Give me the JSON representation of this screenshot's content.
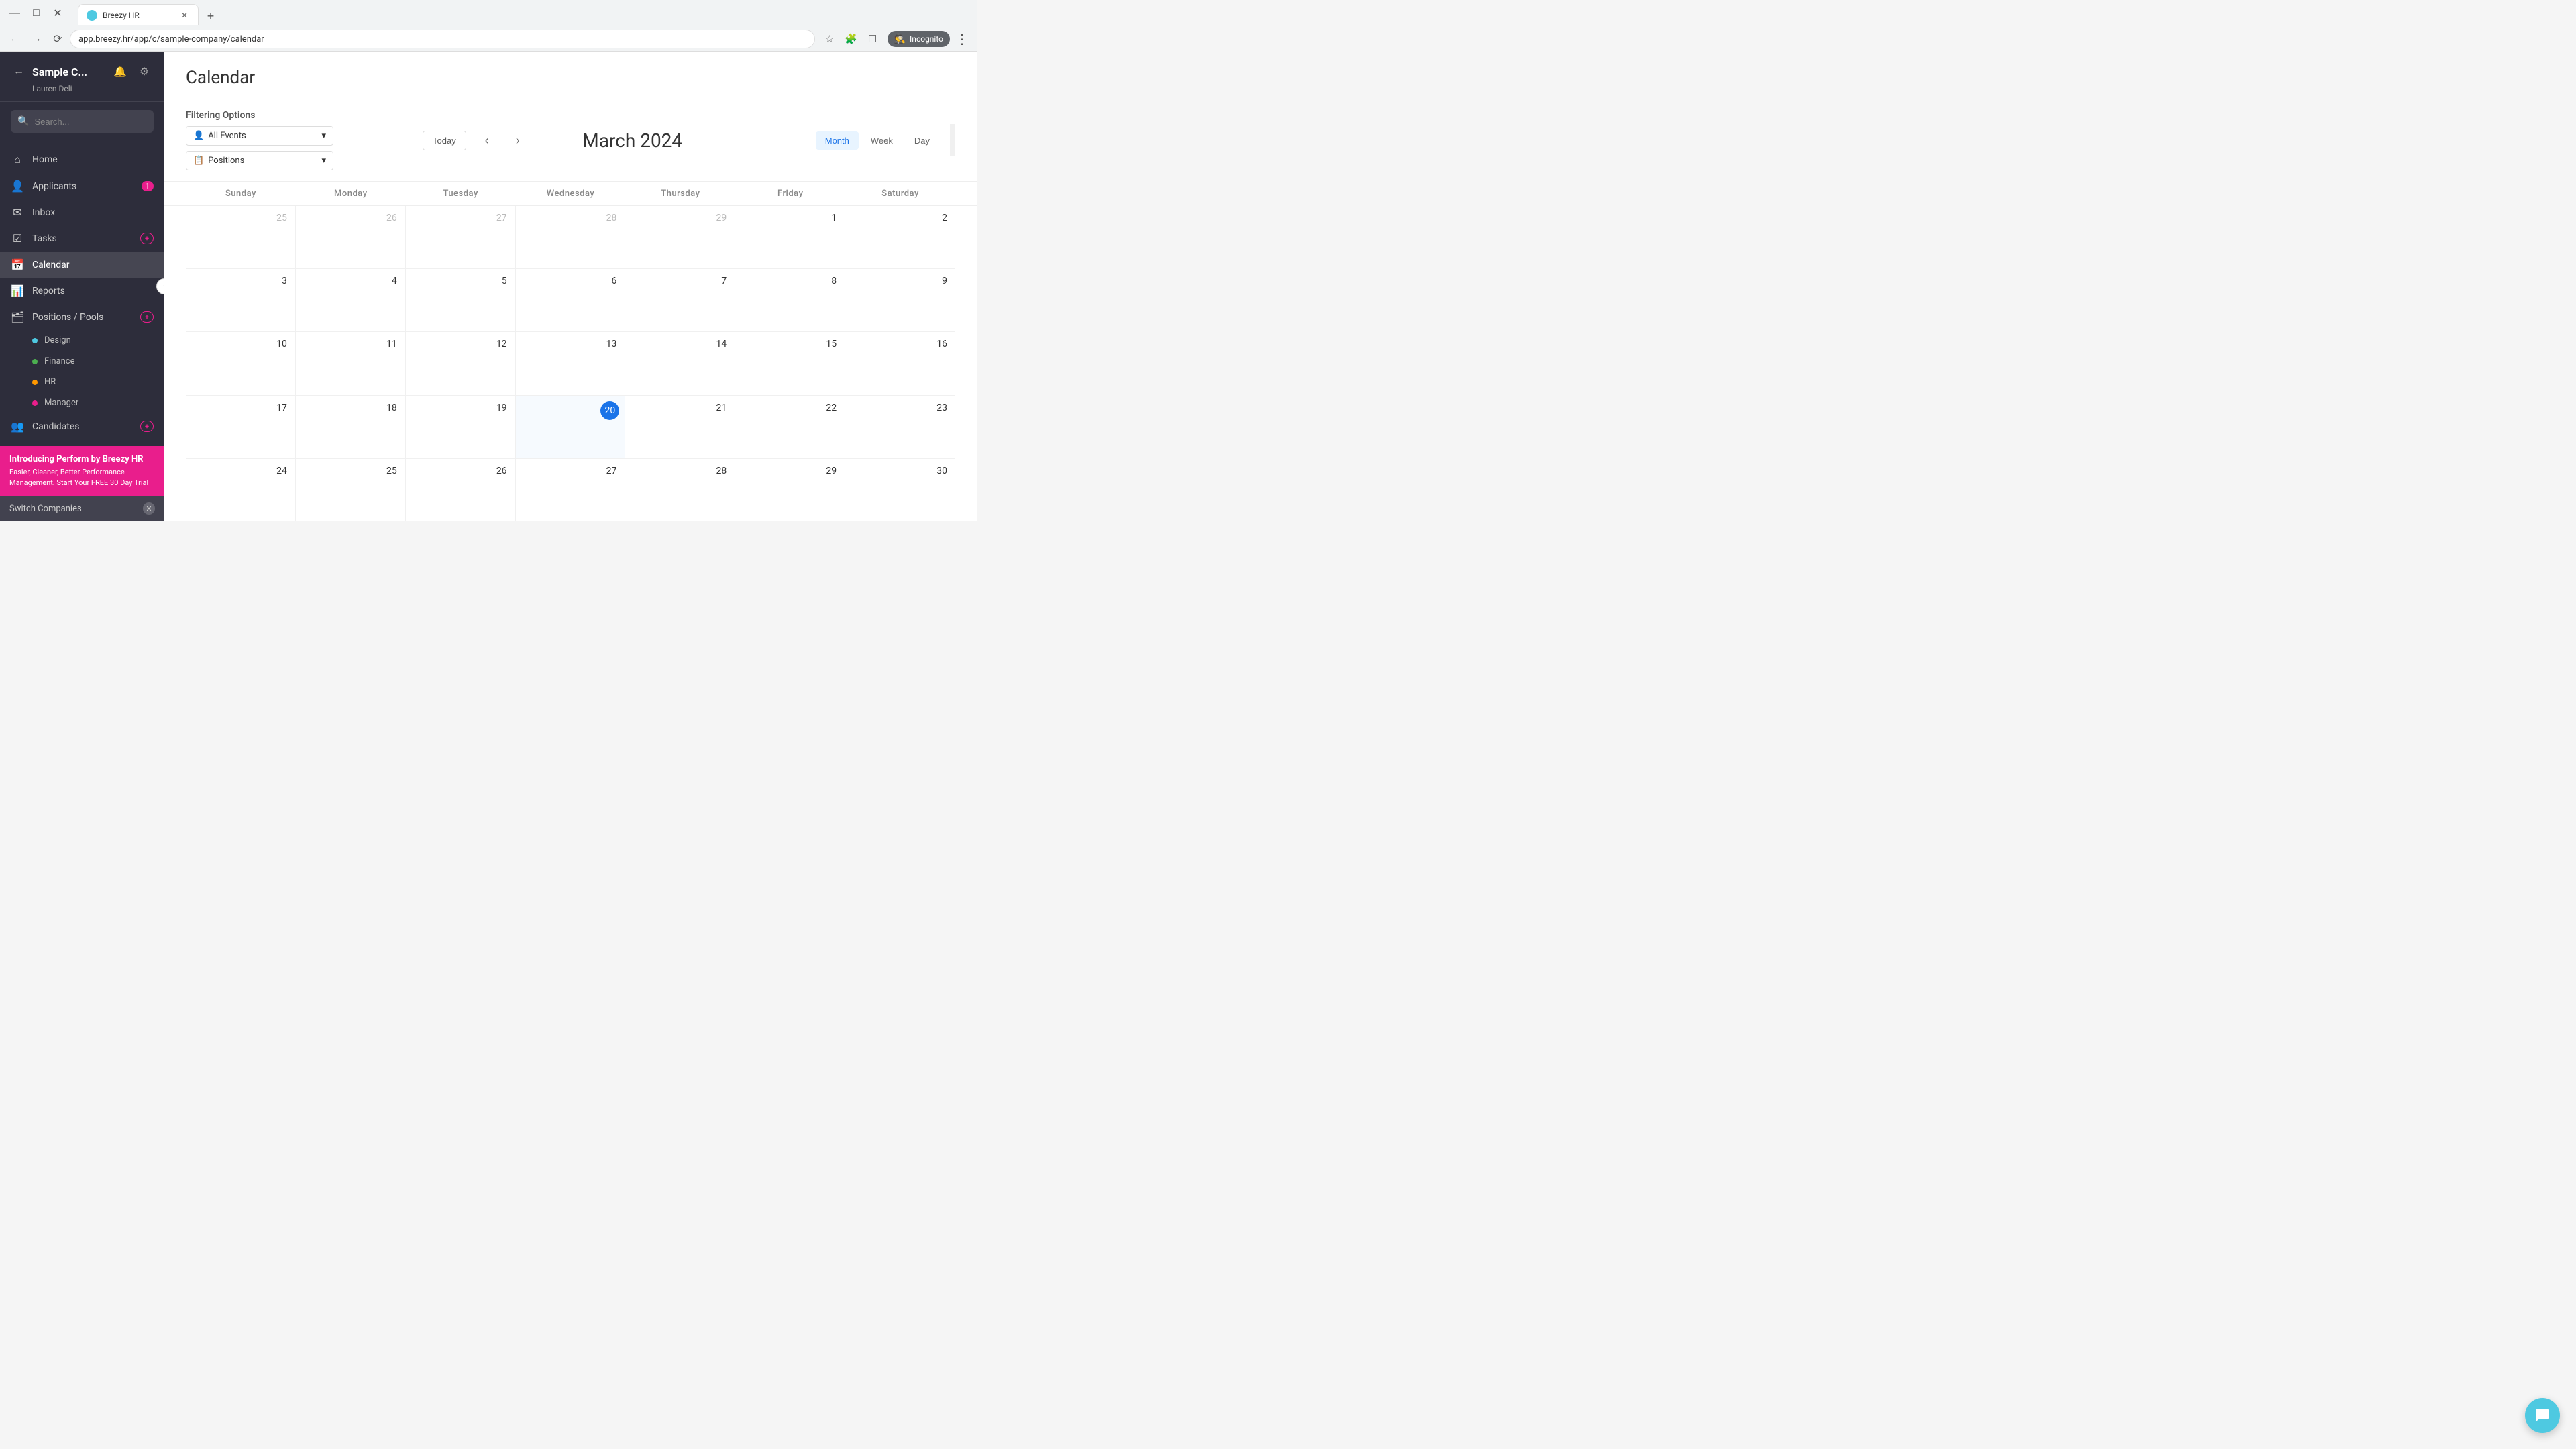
{
  "browser": {
    "tab_label": "Breezy HR",
    "url": "app.breezy.hr/app/c/sample-company/calendar",
    "incognito_label": "Incognito"
  },
  "sidebar": {
    "company_name": "Sample C...",
    "user_name": "Lauren Deli",
    "search_placeholder": "Search...",
    "collapse_icon": "‹",
    "nav_items": [
      {
        "id": "home",
        "label": "Home",
        "icon": "⌂",
        "badge": null
      },
      {
        "id": "applicants",
        "label": "Applicants",
        "icon": "👤",
        "badge": "1"
      },
      {
        "id": "inbox",
        "label": "Inbox",
        "icon": "✉",
        "badge": null
      },
      {
        "id": "tasks",
        "label": "Tasks",
        "icon": "☑",
        "badge": "+"
      },
      {
        "id": "calendar",
        "label": "Calendar",
        "icon": "📅",
        "badge": null,
        "active": true
      },
      {
        "id": "reports",
        "label": "Reports",
        "icon": "📊",
        "badge": null
      },
      {
        "id": "positions_pools",
        "label": "Positions / Pools",
        "icon": "🗂",
        "badge": "+"
      }
    ],
    "sub_items": [
      {
        "id": "design",
        "label": "Design",
        "color": "cyan"
      },
      {
        "id": "finance",
        "label": "Finance",
        "color": "green"
      },
      {
        "id": "hr",
        "label": "HR",
        "color": "orange"
      },
      {
        "id": "manager",
        "label": "Manager",
        "color": "pink"
      }
    ],
    "candidates": {
      "label": "Candidates",
      "badge": "+"
    },
    "promo": {
      "title": "Introducing Perform by Breezy HR",
      "text": "Easier, Cleaner, Better Performance Management. Start Your FREE 30 Day Trial"
    },
    "switch_companies": "Switch Companies"
  },
  "page": {
    "title": "Calendar"
  },
  "calendar": {
    "filter_title": "Filtering Options",
    "filter_events": "All Events",
    "filter_positions": "Positions",
    "today_btn": "Today",
    "month_title": "March 2024",
    "view_month": "Month",
    "view_week": "Week",
    "view_day": "Day",
    "day_headers": [
      "Sunday",
      "Monday",
      "Tuesday",
      "Wednesday",
      "Thursday",
      "Friday",
      "Saturday"
    ],
    "weeks": [
      [
        {
          "date": "25",
          "outside": true
        },
        {
          "date": "26",
          "outside": true
        },
        {
          "date": "27",
          "outside": true
        },
        {
          "date": "28",
          "outside": true
        },
        {
          "date": "29",
          "outside": true
        },
        {
          "date": "1",
          "outside": false
        },
        {
          "date": "2",
          "outside": false
        }
      ],
      [
        {
          "date": "3",
          "outside": false
        },
        {
          "date": "4",
          "outside": false
        },
        {
          "date": "5",
          "outside": false
        },
        {
          "date": "6",
          "outside": false
        },
        {
          "date": "7",
          "outside": false
        },
        {
          "date": "8",
          "outside": false
        },
        {
          "date": "9",
          "outside": false
        }
      ],
      [
        {
          "date": "10",
          "outside": false
        },
        {
          "date": "11",
          "outside": false
        },
        {
          "date": "12",
          "outside": false
        },
        {
          "date": "13",
          "outside": false
        },
        {
          "date": "14",
          "outside": false
        },
        {
          "date": "15",
          "outside": false
        },
        {
          "date": "16",
          "outside": false
        }
      ],
      [
        {
          "date": "17",
          "outside": false
        },
        {
          "date": "18",
          "outside": false
        },
        {
          "date": "19",
          "outside": false
        },
        {
          "date": "20",
          "outside": false,
          "today": true
        },
        {
          "date": "21",
          "outside": false
        },
        {
          "date": "22",
          "outside": false
        },
        {
          "date": "23",
          "outside": false
        }
      ],
      [
        {
          "date": "24",
          "outside": false
        },
        {
          "date": "25",
          "outside": false
        },
        {
          "date": "26",
          "outside": false
        },
        {
          "date": "27",
          "outside": false
        },
        {
          "date": "28",
          "outside": false
        },
        {
          "date": "29",
          "outside": false
        },
        {
          "date": "30",
          "outside": false
        }
      ]
    ]
  }
}
